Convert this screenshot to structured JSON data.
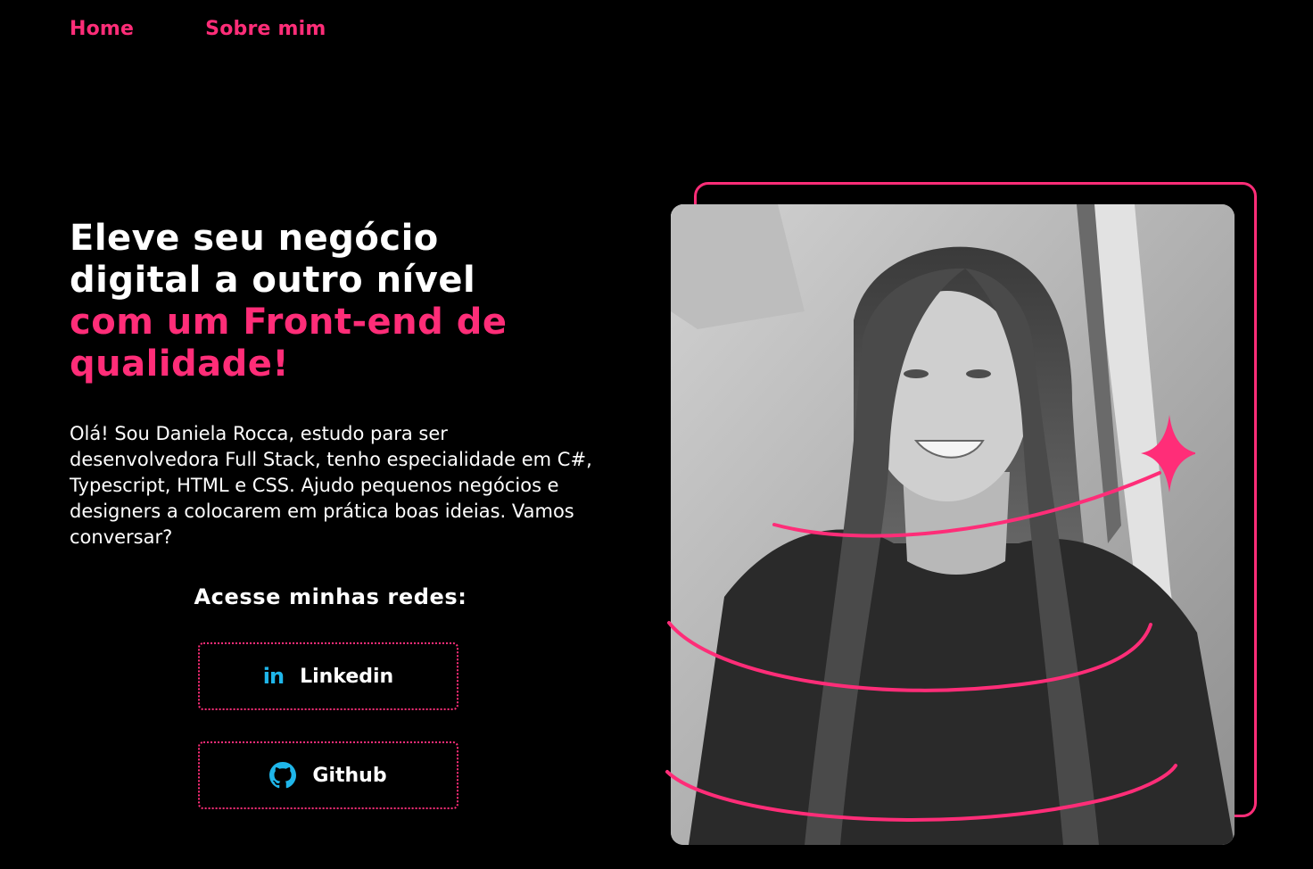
{
  "nav": {
    "items": [
      {
        "label": "Home"
      },
      {
        "label": "Sobre mim"
      }
    ]
  },
  "hero": {
    "headline_line1": "Eleve seu negócio",
    "headline_line2": "digital a outro nível",
    "headline_line3": "com um Front-end de",
    "headline_line4": "qualidade!",
    "bio": "Olá! Sou Daniela Rocca, estudo para ser desenvolvedora Full Stack, tenho especialidade em C#, Typescript, HTML e CSS. Ajudo pequenos negócios e designers a colocarem em prática boas ideias. Vamos conversar?"
  },
  "socials": {
    "title": "Acesse minhas redes:",
    "linkedin": {
      "label": "Linkedin",
      "icon": "linkedin-icon"
    },
    "github": {
      "label": "Github",
      "icon": "github-icon"
    }
  },
  "colors": {
    "accent": "#ff2d78",
    "background": "#000000",
    "icon_blue": "#1fb6ea",
    "text": "#ffffff"
  }
}
